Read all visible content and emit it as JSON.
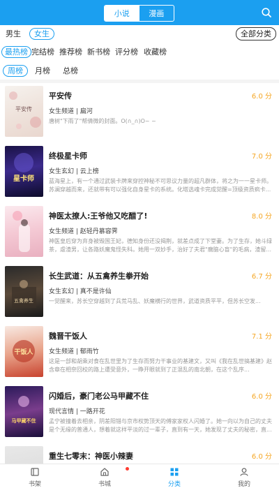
{
  "header": {
    "tabs": [
      {
        "label": "小说",
        "active": true
      },
      {
        "label": "漫画",
        "active": false
      }
    ],
    "search_icon": "search-icon",
    "colors": {
      "accent": "#1b9ff0",
      "score": "#f5a623"
    }
  },
  "filters": {
    "gender": [
      "男生",
      "女生"
    ],
    "gender_selected": "女生",
    "all_categories": "全部分类",
    "ranks": [
      "最热榜",
      "完结榜",
      "推荐榜",
      "新书榜",
      "评分榜",
      "收藏榜"
    ],
    "rank_selected": "最热榜",
    "periods": [
      "周榜",
      "月榜",
      "总榜"
    ],
    "period_selected": "周榜"
  },
  "books": [
    {
      "title": "平安传",
      "score": "6.0 分",
      "channel": "女生频道",
      "author": "扁河",
      "desc": "唐树\"下雨了\"帮倩微的封面。O(∩_∩)O~\n~"
    },
    {
      "title": "终极星卡师",
      "score": "7.0 分",
      "channel": "女生玄幻",
      "author": "云上榜",
      "desc": "蓝海星上，有一个通过武装卡牌来穿控神秘不可思议力量的超凡群体，将之为一一星卡师。苏澜穿越而来，还就带有可以强化自身星卡的系统。化塔选魂卡完成觉醒=顶级资质疯卡..."
    },
    {
      "title": "神医太撩人:王爷他又吃醋了!",
      "score": "8.0 分",
      "channel": "女生频道",
      "author": "赵轻丹慕容霁",
      "desc": "神医皇后穿为弃身被毁国王妃，德知身份还没揭荆，就差点成了下堂妻。为了生存，她斗绿茶，虐渣男，让各路妖魔鬼怪失科。她用一双妙手，治好了夫君\"瘸脑心盲\"的毛病，渣留..."
    },
    {
      "title": "长生武道：从五禽养生拳开始",
      "score": "6.7 分",
      "channel": "女生玄幻",
      "author": "真不是许仙",
      "desc": "一觉醒来，苏长空穿越到了兵荒马乱、妖魔横行的世界，武道资质平平，但苏长空发..."
    },
    {
      "title": "魏晋干饭人",
      "score": "7.1 分",
      "channel": "女生频道",
      "author": "郁雨竹",
      "desc": "这是一部和胡乘对食在乱世里为了生存而努力干事业的基建文，又叫《我在乱世搞基建》赵含章在相奈回校的路上遭受意外，一睁开眼就到了正混乱的南北朝，在这个乱序..."
    },
    {
      "title": "闪婚后，豪门老公马甲藏不住",
      "score": "6.0 分",
      "channel": "现代言情",
      "author": "一路开花",
      "desc": "孟宁被撞着去相亲，阴差阳错与京市权势顶天的傅家家权人闪婚了。她一向以为自己的丈夫是个无缘的普通人，想着就这样平淡的过一辈子，直到有一天，她发现了丈夫的秘密，直..."
    },
    {
      "title": "重生七零末：神医小辣妻",
      "score": "6.0 分",
      "channel": "",
      "author": "",
      "desc": ""
    }
  ],
  "bottom_nav": [
    {
      "label": "书架",
      "icon": "bookshelf-icon",
      "active": false
    },
    {
      "label": "书城",
      "icon": "home-icon",
      "active": false
    },
    {
      "label": "分类",
      "icon": "category-grid-icon",
      "active": true
    },
    {
      "label": "我的",
      "icon": "profile-icon",
      "active": false
    }
  ]
}
